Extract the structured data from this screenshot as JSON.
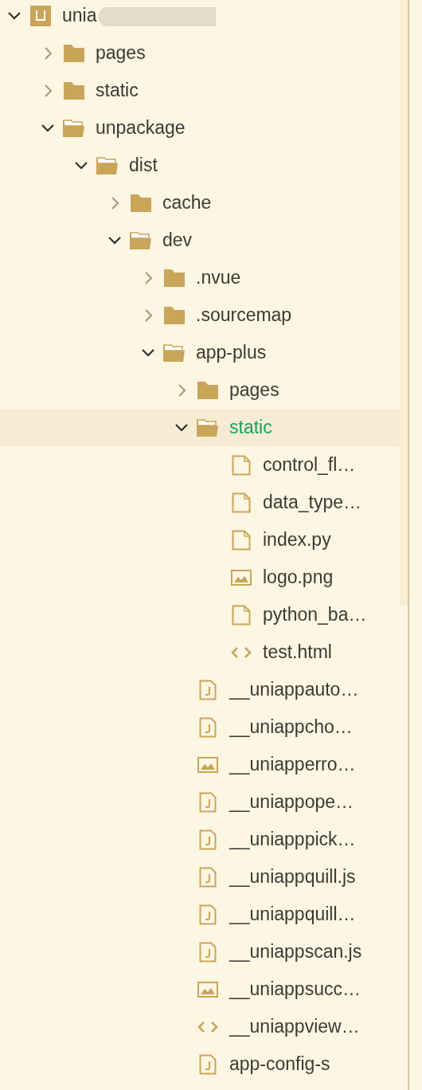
{
  "tree": [
    {
      "name": "unia",
      "kind": "project",
      "expanded": true,
      "selected": false,
      "children": [
        {
          "name": "pages",
          "kind": "folder",
          "expanded": false,
          "selected": false
        },
        {
          "name": "static",
          "kind": "folder",
          "expanded": false,
          "selected": false
        },
        {
          "name": "unpackage",
          "kind": "folder",
          "expanded": true,
          "selected": false,
          "children": [
            {
              "name": "dist",
              "kind": "folder",
              "expanded": true,
              "selected": false,
              "children": [
                {
                  "name": "cache",
                  "kind": "folder",
                  "expanded": false,
                  "selected": false
                },
                {
                  "name": "dev",
                  "kind": "folder",
                  "expanded": true,
                  "selected": false,
                  "children": [
                    {
                      "name": ".nvue",
                      "kind": "folder",
                      "expanded": false,
                      "selected": false
                    },
                    {
                      "name": ".sourcemap",
                      "kind": "folder",
                      "expanded": false,
                      "selected": false
                    },
                    {
                      "name": "app-plus",
                      "kind": "folder",
                      "expanded": true,
                      "selected": false,
                      "children": [
                        {
                          "name": "pages",
                          "kind": "folder",
                          "expanded": false,
                          "selected": false
                        },
                        {
                          "name": "static",
                          "kind": "folder",
                          "expanded": true,
                          "selected": true,
                          "children": [
                            {
                              "name": "control_fl…",
                              "kind": "file",
                              "selected": false
                            },
                            {
                              "name": "data_type…",
                              "kind": "file",
                              "selected": false
                            },
                            {
                              "name": "index.py",
                              "kind": "file",
                              "selected": false
                            },
                            {
                              "name": "logo.png",
                              "kind": "image",
                              "selected": false
                            },
                            {
                              "name": "python_ba…",
                              "kind": "file",
                              "selected": false
                            },
                            {
                              "name": "test.html",
                              "kind": "html",
                              "selected": false
                            }
                          ]
                        },
                        {
                          "name": "__uniappauto…",
                          "kind": "script",
                          "selected": false
                        },
                        {
                          "name": "__uniappcho…",
                          "kind": "script",
                          "selected": false
                        },
                        {
                          "name": "__uniapperro…",
                          "kind": "image",
                          "selected": false
                        },
                        {
                          "name": "__uniappope…",
                          "kind": "script",
                          "selected": false
                        },
                        {
                          "name": "__uniapppick…",
                          "kind": "script",
                          "selected": false
                        },
                        {
                          "name": "__uniappquill.js",
                          "kind": "script",
                          "selected": false
                        },
                        {
                          "name": "__uniappquill…",
                          "kind": "script",
                          "selected": false
                        },
                        {
                          "name": "__uniappscan.js",
                          "kind": "script",
                          "selected": false
                        },
                        {
                          "name": "__uniappsucc…",
                          "kind": "image",
                          "selected": false
                        },
                        {
                          "name": "__uniappview…",
                          "kind": "html",
                          "selected": false
                        },
                        {
                          "name": "app-config-s",
                          "kind": "script",
                          "selected": false
                        }
                      ]
                    }
                  ]
                }
              ]
            }
          ]
        }
      ]
    }
  ]
}
